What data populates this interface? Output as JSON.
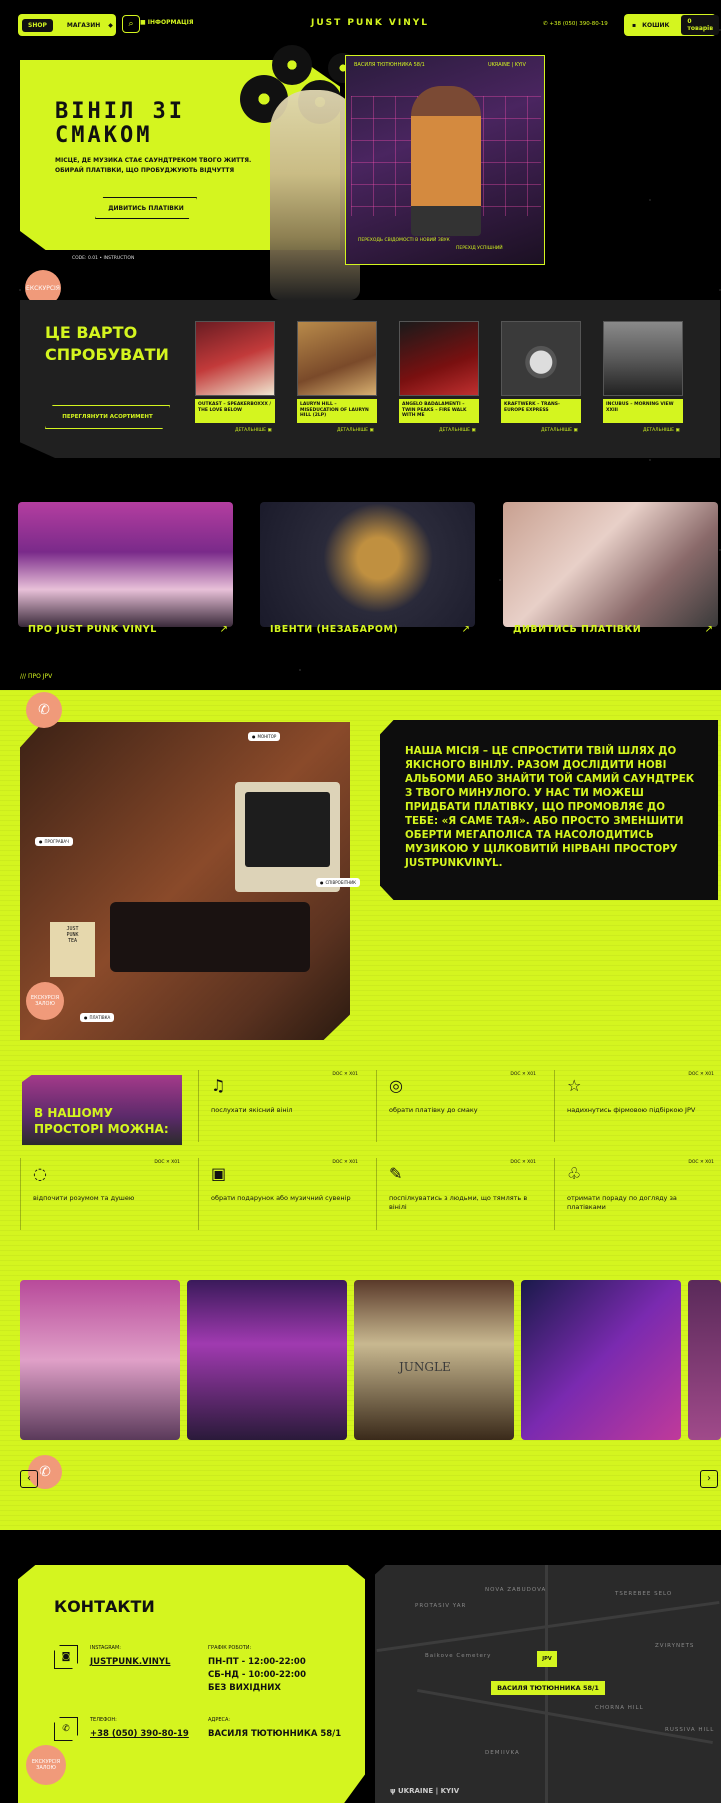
{
  "header": {
    "shop": "SHOP",
    "shops_label": "МАГАЗИН",
    "info": "ІНФОРМАЦІЯ",
    "logo": "JUST PUNK VINYL",
    "phone": "+38 (050) 390-80-19",
    "cart": "КОШИК",
    "cart_count": "0 товарів"
  },
  "hero": {
    "title_line1": "ВІНІЛ ЗІ",
    "title_line2": "СМАКОМ",
    "text": "МІСЦЕ, ДЕ МУЗИКА СТАЄ САУНДТРЕКОМ ТВОГО ЖИТТЯ. ОБИРАЙ ПЛАТІВКИ, ЩО ПРОБУДЖУЮТЬ ВІДЧУТТЯ",
    "button": "ДИВИТИСЬ ПЛАТІВКИ",
    "note": "CODE: 0.01 • INSTRUCTION",
    "video_tag_left": "ВАСИЛЯ ТЮТЮННИКА 58/1",
    "video_tag_right": "UKRAINE | KYIV",
    "video_caption": "ПЕРЕХОДЬ СВІДОМОСТІ В НОВИЙ ЗВУК",
    "video_caption2": "ПЕРЕХІД УСПІШНИЙ",
    "peach": "ЕКСКУРСІЯ"
  },
  "try": {
    "title_line1": "ЦЕ ВАРТО",
    "title_line2": "СПРОБУВАТИ",
    "button": "ПЕРЕГЛЯНУТИ АСОРТИМЕНТ",
    "details": "ДЕТАЛЬНІШЕ",
    "cards": [
      {
        "label": "OUTKAST – SPEAKERBOXXX / THE LOVE BELOW"
      },
      {
        "label": "LAURYN HILL – MISEDUCATION OF LAURYN HILL (2LP)"
      },
      {
        "label": "ANGELO BADALAMENTI – TWIN PEAKS – FIRE WALK WITH ME"
      },
      {
        "label": "KRAFTWERK – TRANS-EUROPE EXPRESS"
      },
      {
        "label": "INCUBUS – MORNING VIEW XXIII"
      }
    ]
  },
  "categories": [
    {
      "label": "ПРО JUST PUNK VINYL"
    },
    {
      "label": "ІВЕНТИ (НЕЗАБАРОМ)"
    },
    {
      "label": "ДИВИТИСЬ ПЛАТІВКИ"
    }
  ],
  "about": {
    "section_label": "/// ПРО JPV",
    "mission": "НАША МІСІЯ – ЦЕ СПРОСТИТИ ТВІЙ ШЛЯХ ДО ЯКІСНОГО ВІНІЛУ. РАЗОМ ДОСЛІДИТИ НОВІ АЛЬБОМИ АБО ЗНАЙТИ ТОЙ САМИЙ САУНДТРЕК З ТВОГО МИНУЛОГО. У НАС ТИ МОЖЕШ ПРИДБАТИ ПЛАТІВКУ, ЩО ПРОМОВЛЯЄ ДО ТЕБЕ: «Я САМЕ ТАЯ». АБО ПРОСТО ЗМЕНШИТИ ОБЕРТИ МЕГАПОЛІСА ТА НАСОЛОДИТИСЬ МУЗИКОЮ У ЦІЛКОВИТІЙ НІРВАНІ ПРОСТОРУ JUSTPUNKVINYL.",
    "hotspots": [
      "МОНІТОР",
      "ПРОГРАВАЧ",
      "СПІВРОБІТНИК",
      "ПЛАТІВКА"
    ],
    "peach": "ЕКСКУРСІЯ ЗАЛОЮ",
    "space_title": "В НАШОМУ ПРОСТОРІ МОЖНА:",
    "code": "DOC ✕ X01",
    "features": [
      {
        "icon": "music-note-icon",
        "text": "послухати якісний вініл"
      },
      {
        "icon": "vinyl-icon",
        "text": "обрати платівку до смаку"
      },
      {
        "icon": "star-icon",
        "text": "надихнутись фірмовою підбіркою JPV"
      },
      {
        "icon": "chat-icon",
        "text": "відпочити розумом та душею"
      },
      {
        "icon": "gift-icon",
        "text": "обрати подарунок або музичний сувенір"
      },
      {
        "icon": "speech-icon",
        "text": "поспілкуватись з людьми, що тямлять в вінілі"
      },
      {
        "icon": "care-icon",
        "text": "отримати пораду по догляду за платівками"
      }
    ],
    "gallery_jungle": "JUNGLE"
  },
  "contacts": {
    "title": "КОНТАКТИ",
    "instagram_label": "INSTAGRAM:",
    "instagram": "JUSTPUNK.VINYL",
    "phone_label": "ТЕЛЕФОН:",
    "phone": "+38 (050) 390-80-19",
    "hours_label": "ГРАФІК РОБОТИ:",
    "hours1": "ПН-ПТ - 12:00-22:00",
    "hours2": "СБ-НД - 10:00-22:00",
    "hours3": "БЕЗ ВИХІДНИХ",
    "address_label": "АДРЕСА:",
    "address": "ВАСИЛЯ ТЮТЮННИКА 58/1",
    "peach": "ЕКСКУРСІЯ ЗАЛОЮ"
  },
  "map": {
    "pin": "JPV",
    "address": "ВАСИЛЯ ТЮТЮННИКА 58/1",
    "footer": "UKRAINE | KYIV",
    "labels": [
      "NOVA ZABUDOVA",
      "PROTASIV YAR",
      "TSEREBEE SELO",
      "ZVIRYNETS",
      "Baikove Cemetery",
      "CHORNA HILL",
      "DEMIIVKA",
      "RUSSIVA HILL"
    ]
  }
}
